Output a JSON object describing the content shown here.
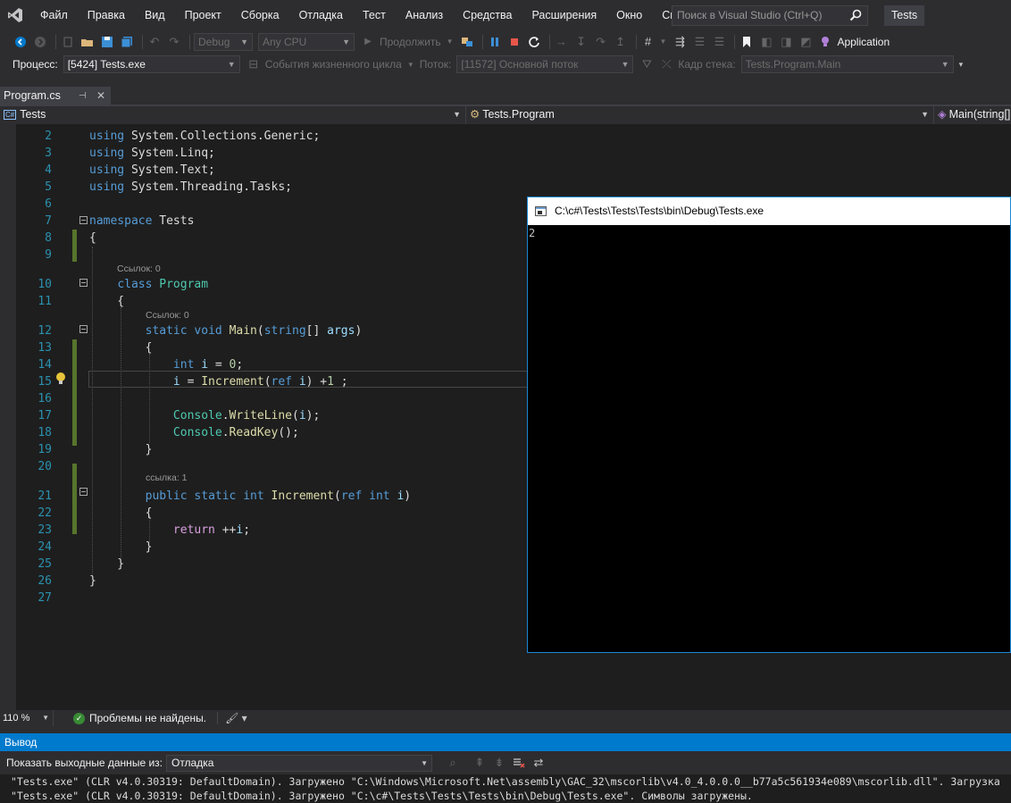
{
  "menu": {
    "items": [
      "Файл",
      "Правка",
      "Вид",
      "Проект",
      "Сборка",
      "Отладка",
      "Тест",
      "Анализ",
      "Средства",
      "Расширения",
      "Окно",
      "Справка"
    ],
    "search_placeholder": "Поиск в Visual Studio (Ctrl+Q)",
    "solution_name": "Tests"
  },
  "toolbar": {
    "config": "Debug",
    "platform": "Any CPU",
    "continue_label": "Продолжить",
    "application_insights": "Application"
  },
  "debug_location": {
    "process_label": "Процесс:",
    "process_value": "[5424] Tests.exe",
    "lifecycle_label": "События жизненного цикла",
    "thread_label": "Поток:",
    "thread_value": "[11572] Основной поток",
    "stack_label": "Кадр стека:",
    "stack_value": "Tests.Program.Main"
  },
  "document_tab": {
    "name": "Program.cs"
  },
  "navigation": {
    "project": "Tests",
    "type": "Tests.Program",
    "member": "Main(string[]"
  },
  "code": {
    "lines": [
      {
        "n": "2",
        "tokens": [
          [
            "kw",
            "using"
          ],
          [
            "",
            " System.Collections.Generic;"
          ]
        ]
      },
      {
        "n": "3",
        "tokens": [
          [
            "kw",
            "using"
          ],
          [
            "",
            " System.Linq;"
          ]
        ]
      },
      {
        "n": "4",
        "tokens": [
          [
            "kw",
            "using"
          ],
          [
            "",
            " System.Text;"
          ]
        ]
      },
      {
        "n": "5",
        "tokens": [
          [
            "kw",
            "using"
          ],
          [
            "",
            " System.Threading.Tasks;"
          ]
        ]
      },
      {
        "n": "6",
        "tokens": []
      },
      {
        "n": "7",
        "tokens": [
          [
            "kw",
            "namespace"
          ],
          [
            "",
            " Tests"
          ]
        ]
      },
      {
        "n": "8",
        "tokens": [
          [
            "",
            "{"
          ]
        ]
      },
      {
        "n": "9",
        "tokens": []
      },
      {
        "n": "10",
        "tokens": [
          [
            "",
            "    "
          ],
          [
            "kw",
            "class"
          ],
          [
            "",
            " "
          ],
          [
            "ty",
            "Program"
          ]
        ]
      },
      {
        "n": "11",
        "tokens": [
          [
            "",
            "    {"
          ]
        ]
      },
      {
        "n": "12",
        "tokens": [
          [
            "",
            "        "
          ],
          [
            "kw",
            "static"
          ],
          [
            "",
            " "
          ],
          [
            "kw",
            "void"
          ],
          [
            "",
            " "
          ],
          [
            "fn",
            "Main"
          ],
          [
            "",
            "("
          ],
          [
            "kw",
            "string"
          ],
          [
            "",
            "[] "
          ],
          [
            "pm",
            "args"
          ],
          [
            "",
            ")"
          ]
        ]
      },
      {
        "n": "13",
        "tokens": [
          [
            "",
            "        {"
          ]
        ]
      },
      {
        "n": "14",
        "tokens": [
          [
            "",
            "            "
          ],
          [
            "kw",
            "int"
          ],
          [
            "",
            " "
          ],
          [
            "pm",
            "i"
          ],
          [
            "",
            " = "
          ],
          [
            "num",
            "0"
          ],
          [
            "",
            ";"
          ]
        ]
      },
      {
        "n": "15",
        "tokens": [
          [
            "",
            "            "
          ],
          [
            "pm",
            "i"
          ],
          [
            "",
            " = "
          ],
          [
            "fn",
            "Increment"
          ],
          [
            "",
            "("
          ],
          [
            "kw",
            "ref"
          ],
          [
            "",
            " "
          ],
          [
            "pm",
            "i"
          ],
          [
            "",
            ") +"
          ],
          [
            "num",
            "1"
          ],
          [
            "",
            " ;"
          ]
        ]
      },
      {
        "n": "16",
        "tokens": []
      },
      {
        "n": "17",
        "tokens": [
          [
            "",
            "            "
          ],
          [
            "ty",
            "Console"
          ],
          [
            "",
            "."
          ],
          [
            "fn",
            "WriteLine"
          ],
          [
            "",
            "("
          ],
          [
            "pm",
            "i"
          ],
          [
            "",
            ");"
          ]
        ]
      },
      {
        "n": "18",
        "tokens": [
          [
            "",
            "            "
          ],
          [
            "ty",
            "Console"
          ],
          [
            "",
            "."
          ],
          [
            "fn",
            "ReadKey"
          ],
          [
            "",
            "();"
          ]
        ]
      },
      {
        "n": "19",
        "tokens": [
          [
            "",
            "        }"
          ]
        ]
      },
      {
        "n": "20",
        "tokens": []
      },
      {
        "n": "21",
        "tokens": [
          [
            "",
            "        "
          ],
          [
            "kw",
            "public"
          ],
          [
            "",
            " "
          ],
          [
            "kw",
            "static"
          ],
          [
            "",
            " "
          ],
          [
            "kw",
            "int"
          ],
          [
            "",
            " "
          ],
          [
            "fn",
            "Increment"
          ],
          [
            "",
            "("
          ],
          [
            "kw",
            "ref"
          ],
          [
            "",
            " "
          ],
          [
            "kw",
            "int"
          ],
          [
            "",
            " "
          ],
          [
            "pm",
            "i"
          ],
          [
            "",
            ")"
          ]
        ]
      },
      {
        "n": "22",
        "tokens": [
          [
            "",
            "        {"
          ]
        ]
      },
      {
        "n": "23",
        "tokens": [
          [
            "",
            "            "
          ],
          [
            "ctl",
            "return"
          ],
          [
            "",
            " ++"
          ],
          [
            "pm",
            "i"
          ],
          [
            "",
            ";"
          ]
        ]
      },
      {
        "n": "24",
        "tokens": [
          [
            "",
            "        }"
          ]
        ]
      },
      {
        "n": "25",
        "tokens": [
          [
            "",
            "    }"
          ]
        ]
      },
      {
        "n": "26",
        "tokens": [
          [
            "",
            "}"
          ]
        ]
      },
      {
        "n": "27",
        "tokens": []
      }
    ],
    "lens": {
      "class_refs": "Ссылок: 0",
      "main_refs": "Ссылок: 0",
      "increment_refs": "ссылка: 1"
    }
  },
  "console": {
    "title": "C:\\c#\\Tests\\Tests\\Tests\\bin\\Debug\\Tests.exe",
    "output": "2"
  },
  "editor_status": {
    "zoom": "110 %",
    "issues": "Проблемы не найдены."
  },
  "output": {
    "title": "Вывод",
    "source_label": "Показать выходные данные из:",
    "source_value": "Отладка",
    "lines": [
      "\"Tests.exe\" (CLR v4.0.30319: DefaultDomain). Загружено \"C:\\Windows\\Microsoft.Net\\assembly\\GAC_32\\mscorlib\\v4.0_4.0.0.0__b77a5c561934e089\\mscorlib.dll\". Загрузка",
      "\"Tests.exe\" (CLR v4.0.30319: DefaultDomain). Загружено \"C:\\c#\\Tests\\Tests\\Tests\\bin\\Debug\\Tests.exe\". Символы загружены."
    ]
  },
  "colors": {
    "accent": "#007acc",
    "editor_bg": "#1e1e1e",
    "chrome_bg": "#2d2d30",
    "keyword": "#569cd6",
    "type": "#4ec9b0",
    "method": "#dcdcaa",
    "line_number": "#2b91af",
    "change_bar": "#57742c"
  }
}
